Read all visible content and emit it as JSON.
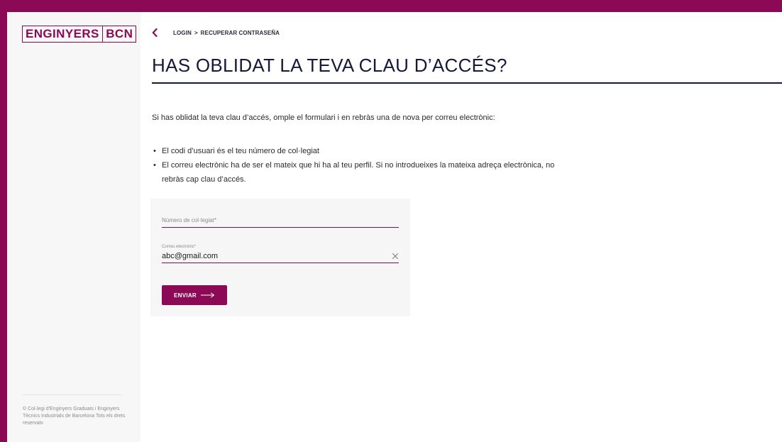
{
  "colors": {
    "brand": "#8c0a55",
    "title": "#15183a",
    "sidebar_bg": "#f7f7f7",
    "form_bg": "#f6f6f6"
  },
  "logo": {
    "left": "ENGINYERS",
    "right": "BCN"
  },
  "sidebar": {
    "copyright": "© Col·legi d'Enginyers Graduats i Enginyers Tècnics Industrials de Barcelona Tots els drets reservats"
  },
  "breadcrumb": {
    "items": [
      {
        "label": "LOGIN"
      },
      {
        "label": "RECUPERAR CONTRASEÑA"
      }
    ],
    "separator": ">"
  },
  "page": {
    "title": "HAS OBLIDAT LA TEVA CLAU D’ACCÉS?",
    "intro": "Si has oblidat la teva clau d’accés, omple el formulari i en rebràs una de nova per correu electrònic:",
    "bullets": [
      "El codi d’usuari és el teu número de col·legiat",
      "El correu electrònic ha de ser el mateix que hi ha al teu perfil.  Si no introdueixes la mateixa adreça electrònica, no rebràs cap clau d’accés."
    ]
  },
  "form": {
    "member_number": {
      "label": "Número de col·legiat*",
      "value": ""
    },
    "email": {
      "label": "Correu electrònic*",
      "value": "abc@gmail.com"
    },
    "submit_label": "ENVIAR"
  },
  "icons": {
    "back": "chevron-left-icon",
    "clear": "close-icon",
    "submit_arrow": "arrow-right-icon"
  }
}
